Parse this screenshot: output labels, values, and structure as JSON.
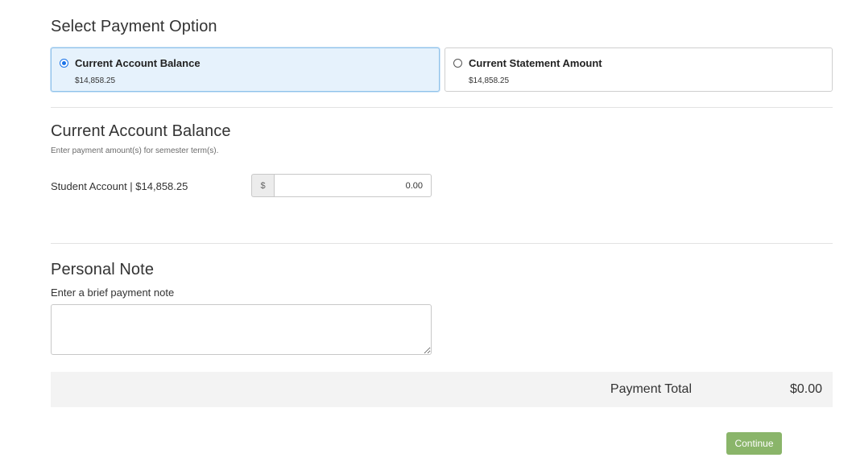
{
  "select_section": {
    "title": "Select Payment Option",
    "options": [
      {
        "label": "Current Account Balance",
        "amount": "$14,858.25",
        "selected": true
      },
      {
        "label": "Current Statement Amount",
        "amount": "$14,858.25",
        "selected": false
      }
    ]
  },
  "balance_section": {
    "title": "Current Account Balance",
    "help": "Enter payment amount(s) for semester term(s).",
    "account_label": "Student Account | $14,858.25",
    "currency_symbol": "$",
    "amount_value": "0.00"
  },
  "note_section": {
    "title": "Personal Note",
    "help": "Enter a brief payment note",
    "value": ""
  },
  "total": {
    "label": "Payment Total",
    "value": "$0.00"
  },
  "actions": {
    "continue_label": "Continue"
  },
  "colors": {
    "selected_bg": "#e6f2fc",
    "continue_bg": "#8ab56a",
    "total_bar_bg": "#f3f3f3"
  }
}
